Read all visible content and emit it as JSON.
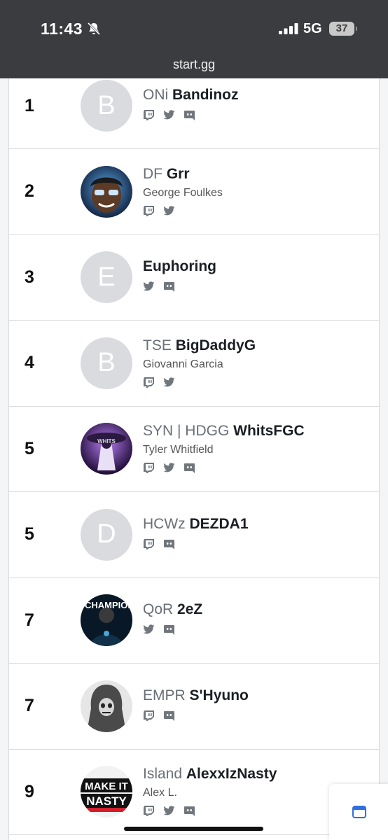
{
  "status_bar": {
    "time": "11:43",
    "network": "5G",
    "battery": "37"
  },
  "browser": {
    "url": "start.gg"
  },
  "entries": [
    {
      "rank": "1",
      "prefix": "ONi",
      "tag": "Bandinoz",
      "real_name": "",
      "avatar_letter": "B",
      "icons": [
        "twitch-icon",
        "twitter-icon",
        "discord-icon"
      ]
    },
    {
      "rank": "2",
      "prefix": "DF",
      "tag": "Grr",
      "real_name": "George Foulkes",
      "avatar_letter": "",
      "icons": [
        "twitch-icon",
        "twitter-icon"
      ]
    },
    {
      "rank": "3",
      "prefix": "",
      "tag": "Euphoring",
      "real_name": "",
      "avatar_letter": "E",
      "icons": [
        "twitter-icon",
        "discord-icon"
      ]
    },
    {
      "rank": "4",
      "prefix": "TSE",
      "tag": "BigDaddyG",
      "real_name": "Giovanni Garcia",
      "avatar_letter": "B",
      "icons": [
        "twitch-icon",
        "twitter-icon"
      ]
    },
    {
      "rank": "5",
      "prefix": "SYN | HDGG",
      "tag": "WhitsFGC",
      "real_name": "Tyler Whitfield",
      "avatar_letter": "",
      "icons": [
        "twitch-icon",
        "twitter-icon",
        "discord-icon"
      ]
    },
    {
      "rank": "5",
      "prefix": "HCWz",
      "tag": "DEZDA1",
      "real_name": "",
      "avatar_letter": "D",
      "icons": [
        "twitch-icon",
        "discord-icon"
      ]
    },
    {
      "rank": "7",
      "prefix": "QoR",
      "tag": "2eZ",
      "real_name": "",
      "avatar_letter": "",
      "icons": [
        "twitter-icon",
        "discord-icon"
      ]
    },
    {
      "rank": "7",
      "prefix": "EMPR",
      "tag": "S'Hyuno",
      "real_name": "",
      "avatar_letter": "",
      "icons": [
        "twitch-icon",
        "discord-icon"
      ]
    },
    {
      "rank": "9",
      "prefix": "Island",
      "tag": "AlexxIzNasty",
      "real_name": "Alex L.",
      "avatar_letter": "",
      "icons": [
        "twitch-icon",
        "twitter-icon",
        "discord-icon"
      ],
      "avatar_text": [
        "MAKE IT",
        "NASTY"
      ]
    }
  ]
}
